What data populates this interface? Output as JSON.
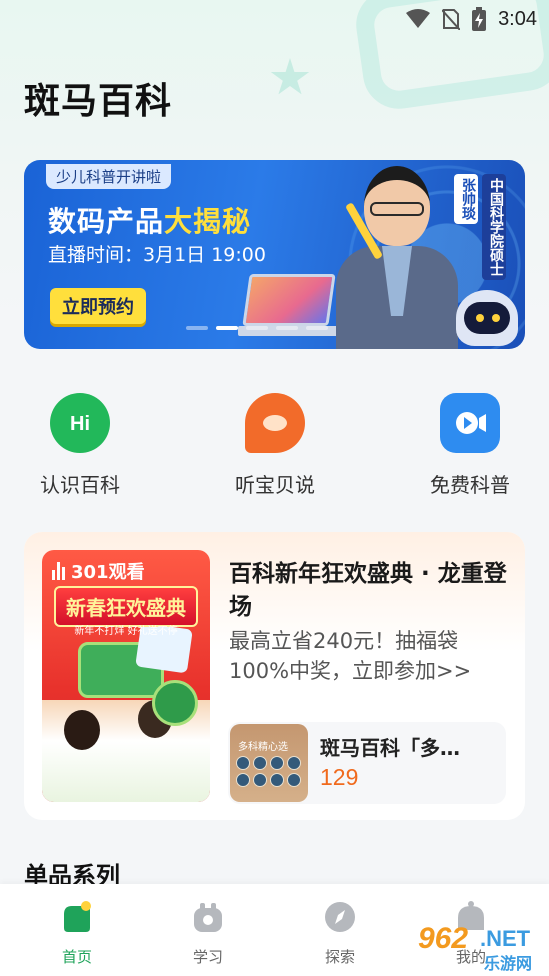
{
  "status_bar": {
    "time": "3:04",
    "icons": [
      "wifi-icon",
      "no-sim-icon",
      "battery-charging-icon"
    ]
  },
  "page": {
    "title": "斑马百科"
  },
  "banner": {
    "tag": "少儿科普开讲啦",
    "headline_part1": "数码产品",
    "headline_part2": "大揭秘",
    "time_text": "直播时间：3月1日 19:00",
    "button_label": "立即预约",
    "presenter_name": "张帅琰",
    "presenter_title": "中国科学院硕士",
    "page_count": 5,
    "active_page": 1
  },
  "quick_actions": [
    {
      "label": "认识百科",
      "icon": "hi-bubble-icon",
      "color": "#22b85a"
    },
    {
      "label": "听宝贝说",
      "icon": "flame-icon",
      "color": "#f26b2a"
    },
    {
      "label": "免费科普",
      "icon": "video-camera-icon",
      "color": "#2e8cf0"
    }
  ],
  "promo": {
    "viewer_count": "301观看",
    "cover_title": "新春狂欢盛典",
    "cover_sub": "新年不打烊 好礼送不停",
    "title": "百科新年狂欢盛典 · 龙重登场",
    "desc": "最高立省240元！抽福袋100%中奖，立即参加>>",
    "product": {
      "thumb_title": "多科精心选",
      "name": "斑马百科「多…",
      "price": "129"
    }
  },
  "section": {
    "title": "单品系列"
  },
  "tabs": [
    {
      "label": "首页",
      "icon": "home-icon",
      "active": true
    },
    {
      "label": "学习",
      "icon": "study-icon",
      "active": false
    },
    {
      "label": "探索",
      "icon": "compass-icon",
      "active": false
    },
    {
      "label": "我的",
      "icon": "profile-icon",
      "active": false
    }
  ],
  "watermark": {
    "num": "962",
    "net": ".NET",
    "sub": "乐游网"
  },
  "colors": {
    "accent_green": "#1fa35a",
    "price_orange": "#f06a1d",
    "banner_blue": "#1a63d6"
  }
}
